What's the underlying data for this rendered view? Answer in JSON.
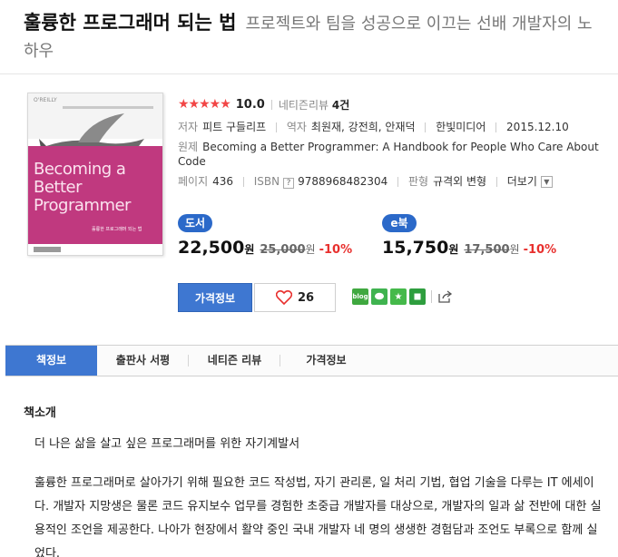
{
  "title": {
    "main": "훌륭한 프로그래머 되는 법",
    "sub": "프로젝트와 팀을 성공으로 이끄는 선배 개발자의 노하우"
  },
  "cover": {
    "title_text": "Becoming a Better Programmer",
    "korean_subtitle": "훌륭한 프로그래머 되는 법",
    "publisher_mark": "O'REILLY",
    "colors": {
      "accent": "#c0397f"
    }
  },
  "rating": {
    "stars": "★★★★★",
    "score": "10.0",
    "review_label": "네티즌리뷰",
    "review_count": "4건"
  },
  "meta": {
    "author_label": "저자",
    "author": "피트 구들리프",
    "translator_label": "역자",
    "translators": "최원재, 강전희, 안재덕",
    "publisher": "한빛미디어",
    "date": "2015.12.10",
    "original_label": "원제",
    "original_title": "Becoming a Better Programmer: A Handbook for People Who Care About Code",
    "pages_label": "페이지",
    "pages": "436",
    "isbn_label": "ISBN",
    "isbn_help": "?",
    "isbn": "9788968482304",
    "edition_label": "판형",
    "edition": "규격외 변형",
    "more_label": "더보기"
  },
  "prices": {
    "print": {
      "badge": "도서",
      "price": "22,500",
      "won": "원",
      "original": "25,000",
      "original_won": "원",
      "discount": "-10%"
    },
    "ebook": {
      "badge": "e북",
      "price": "15,750",
      "won": "원",
      "original": "17,500",
      "original_won": "원",
      "discount": "-10%"
    }
  },
  "actions": {
    "price_info": "가격정보",
    "like_count": "26",
    "share_blog": "blog"
  },
  "tabs": [
    "책정보",
    "출판사 서평",
    "네티즌 리뷰",
    "가격정보"
  ],
  "content": {
    "section_title": "책소개",
    "lead": "더 나은 삶을 살고 싶은 프로그래머를 위한 자기계발서",
    "body": "훌륭한 프로그래머로 살아가기 위해 필요한 코드 작성법, 자기 관리론, 일 처리 기법, 협업 기술을 다루는 IT 에세이다. 개발자 지망생은 물론 코드 유지보수 업무를 경험한 초중급 개발자를 대상으로, 개발자의 일과 삶 전반에 대한 실용적인 조언을 제공한다. 나아가 현장에서 활약 중인 국내 개발자 네 명의 생생한 경험담과 조언도 부록으로 함께 실었다."
  },
  "colors": {
    "primary": "#3e77d1",
    "star": "#f24646",
    "discount": "#e8302e"
  }
}
